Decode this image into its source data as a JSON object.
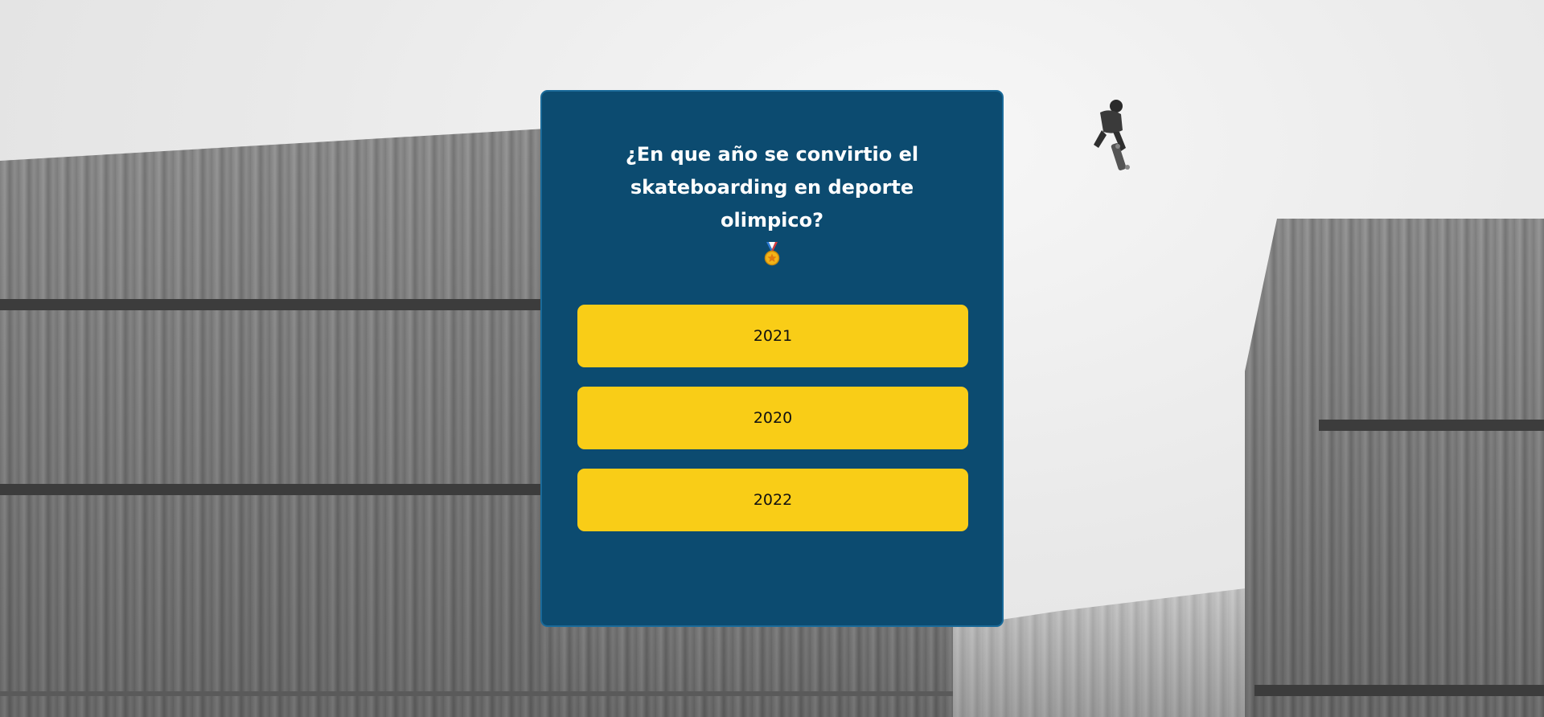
{
  "quiz": {
    "question": "¿En que año se convirtio el skateboarding en deporte olimpico?",
    "question_icon": "medal-icon",
    "answers": [
      {
        "label": "2021"
      },
      {
        "label": "2020"
      },
      {
        "label": "2022"
      }
    ]
  },
  "colors": {
    "card_background": "#0c4b70",
    "answer_background": "#f9cd17",
    "question_text": "#ffffff"
  },
  "background": {
    "description_icon": "background-photo"
  }
}
